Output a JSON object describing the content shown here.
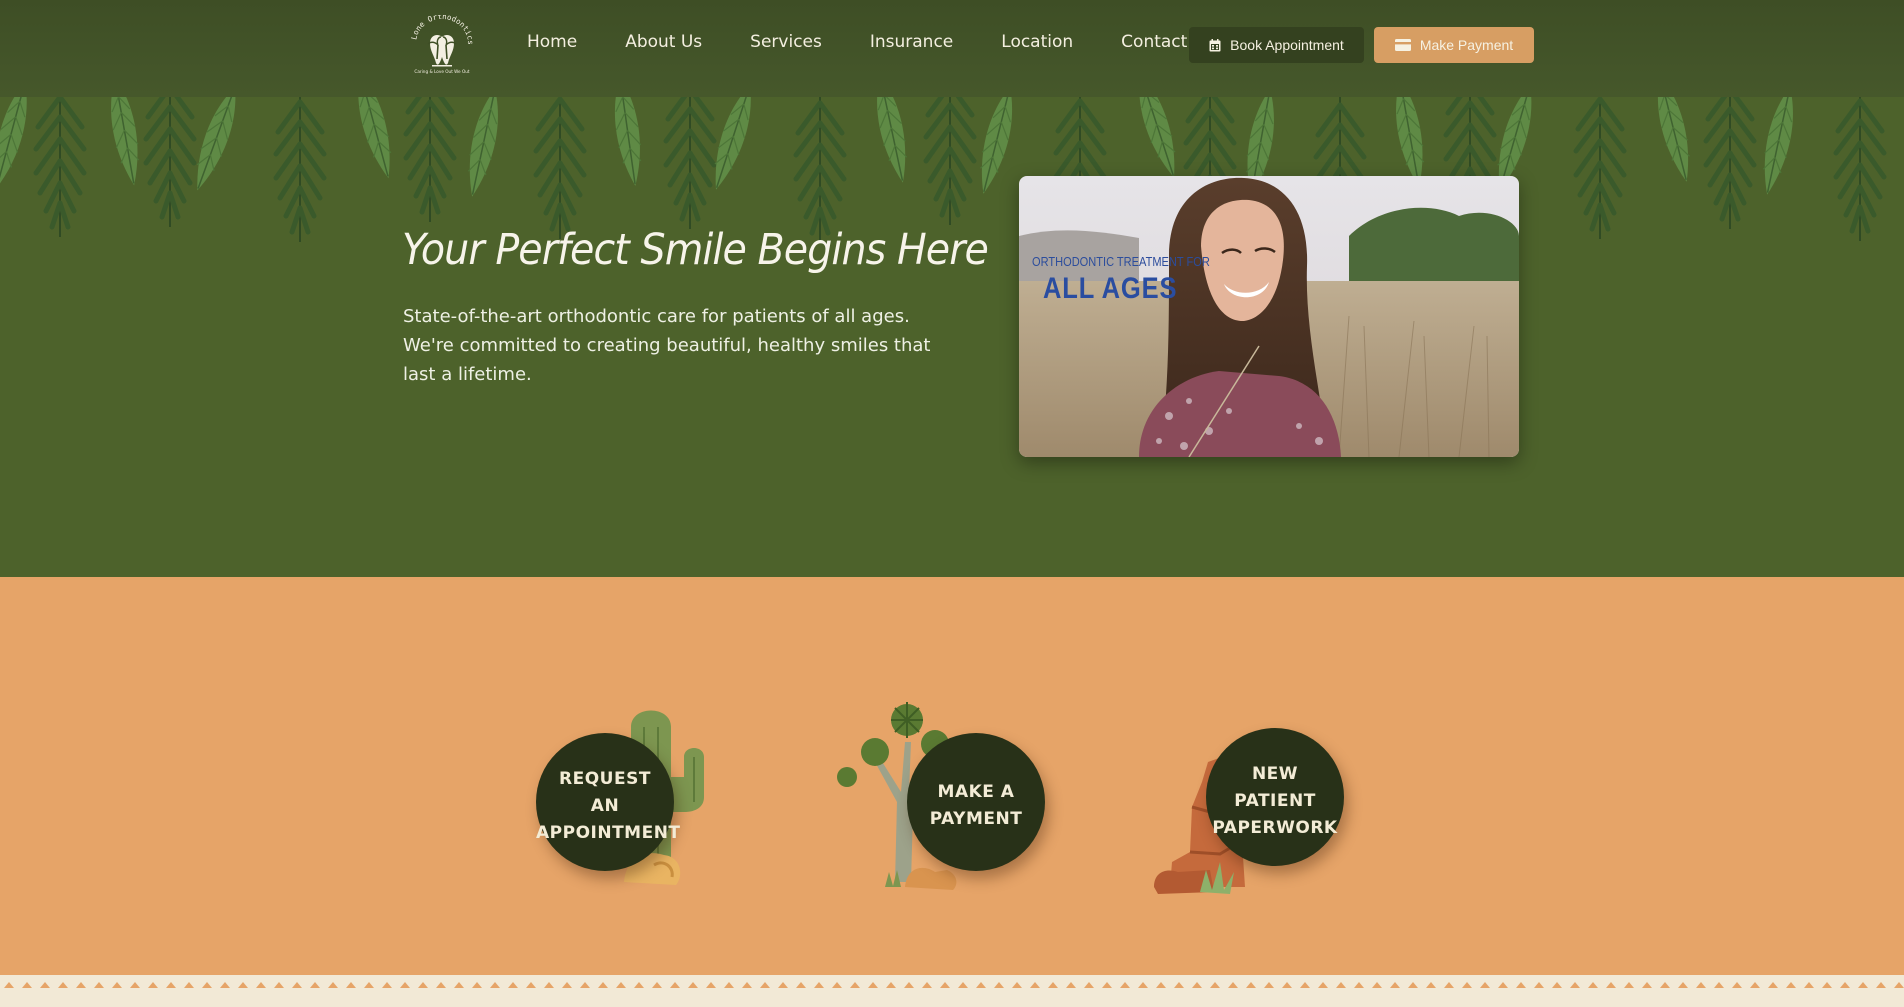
{
  "logo": {
    "text": "Lone Orthodontics",
    "tagline": "Caring & Love Out We Out"
  },
  "nav": {
    "items": [
      {
        "label": "Home"
      },
      {
        "label": "About Us"
      },
      {
        "label": "Services"
      },
      {
        "label": "Insurance"
      },
      {
        "label": "Location"
      },
      {
        "label": "Contact"
      }
    ]
  },
  "header_buttons": {
    "book_label": "Book Appointment",
    "pay_label": "Make Payment",
    "book_icon": "calendar-icon",
    "pay_icon": "credit-card-icon"
  },
  "hero": {
    "title": "Your Perfect Smile Begins Here",
    "text": "State-of-the-art orthodontic care for patients of all ages. We're committed to creating beautiful, healthy smiles that last a lifetime.",
    "photo": {
      "caption_top": "ORTHODONTIC TREATMENT FOR",
      "caption_main": "ALL AGES"
    }
  },
  "ctas": [
    {
      "lines": [
        "REQUEST",
        "AN",
        "APPOINTMENT"
      ],
      "icon": "cactus-icon"
    },
    {
      "lines": [
        "MAKE A",
        "PAYMENT"
      ],
      "icon": "joshua-tree-icon"
    },
    {
      "lines": [
        "NEW",
        "PATIENT",
        "PAPERWORK"
      ],
      "icon": "red-rock-icon"
    }
  ],
  "colors": {
    "header": "#3e4e25",
    "hero": "#4d622b",
    "sand": "#e7c98a",
    "orange": "#e6a468",
    "circle": "#283118",
    "pay_button": "#d79e63",
    "book_button": "#34411f"
  }
}
